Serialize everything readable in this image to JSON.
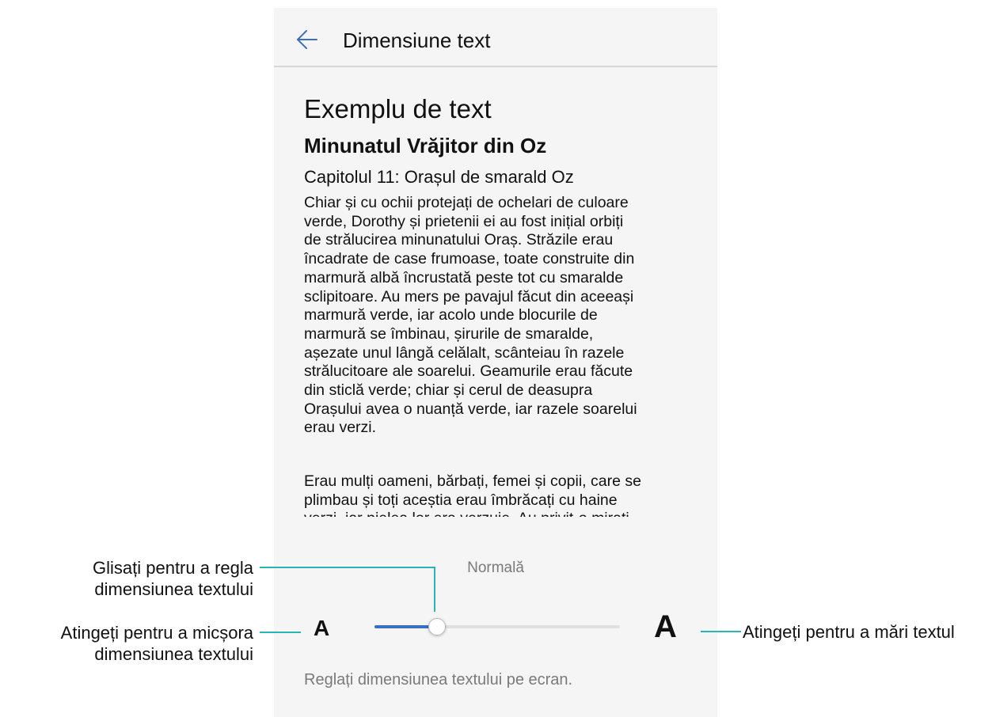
{
  "header": {
    "title": "Dimensiune text",
    "back_icon": "arrow-left-icon"
  },
  "preview": {
    "sample_heading": "Exemplu de text",
    "book_title": "Minunatul Vrăjitor din Oz",
    "chapter_title": "Capitolul 11: Orașul de smarald Oz",
    "paragraph_1": [
      "Chiar și cu ochii protejați de ochelari de culoare",
      "verde, Dorothy și prietenii ei au fost inițial orbiți",
      "de strălucirea minunatului Oraș. Străzile erau",
      "încadrate de case frumoase, toate construite din",
      "marmură albă încrustată peste tot cu smaralde",
      "sclipitoare. Au mers pe pavajul făcut din aceeași",
      "marmură verde, iar acolo unde blocurile de",
      "marmură se îmbinau, șirurile de smaralde,",
      "așezate unul lângă celălalt, scânteiau în razele",
      "strălucitoare ale soarelui. Geamurile erau făcute",
      "din sticlă verde; chiar și cerul de deasupra",
      "Orașului avea o nuanță verde, iar razele soarelui",
      "erau verzi."
    ],
    "paragraph_2": [
      "Erau mulți oameni, bărbați, femei și copii, care se",
      "plimbau și toți aceștia erau îmbrăcați cu haine",
      "verzi, iar pielea lor era verzuie. Au privit-o mirați"
    ]
  },
  "size_control": {
    "current_label": "Normală",
    "decrease_label": "A",
    "increase_label": "A",
    "slider_level_fraction": 0.25,
    "accent_color": "#3a6fbf"
  },
  "footer": {
    "hint": "Reglați dimensiunea textului pe ecran."
  },
  "callouts": {
    "slide": [
      "Glisați pentru a regla",
      "dimensiunea textului"
    ],
    "shrink": [
      "Atingeți pentru a micșora",
      "dimensiunea textului"
    ],
    "grow": [
      "Atingeți pentru a mări textul"
    ],
    "line_color": "#2ab3b8"
  }
}
